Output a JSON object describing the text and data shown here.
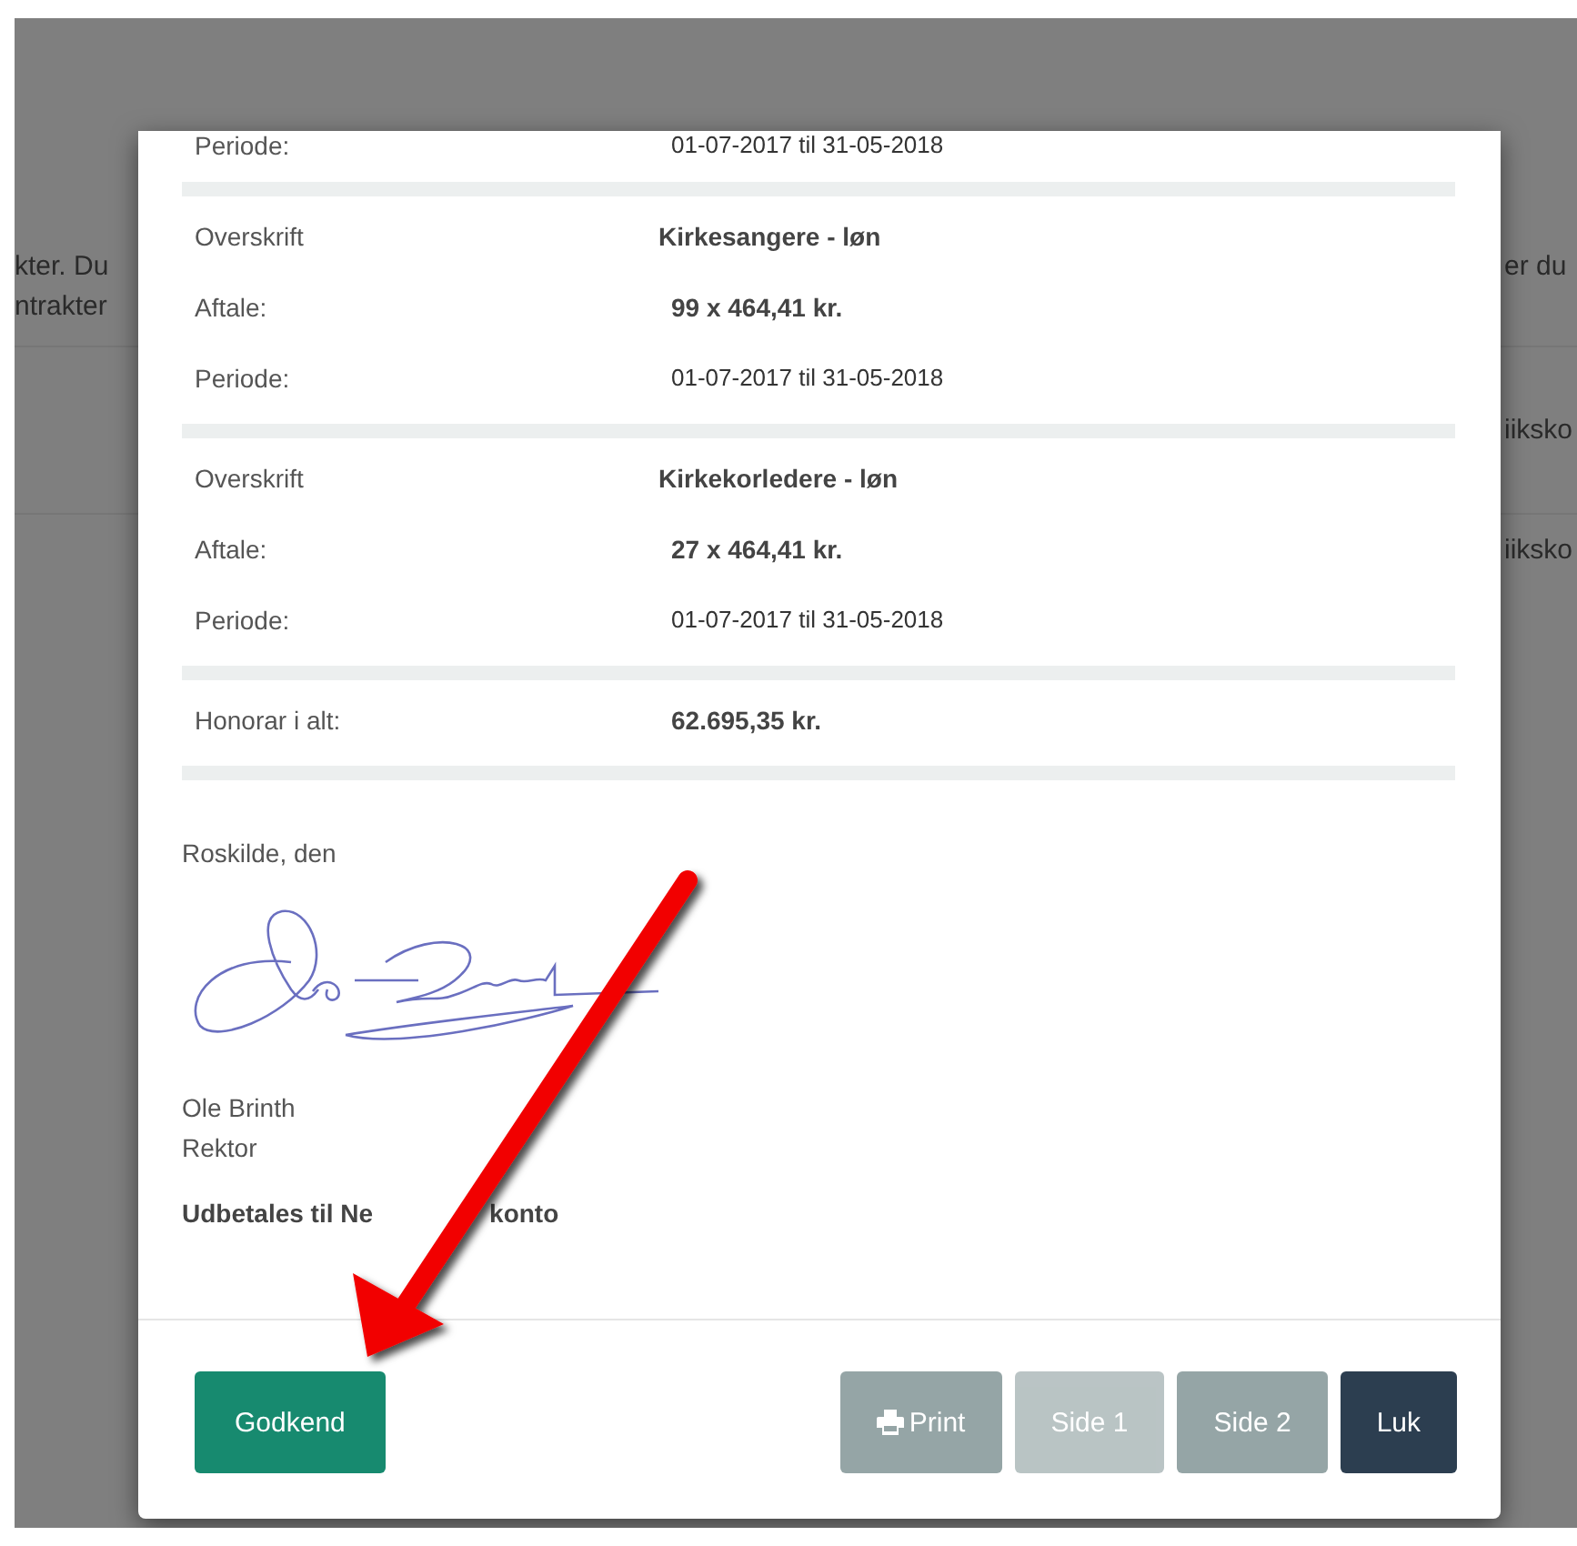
{
  "background_page": {
    "left_texts": [
      "kter. Du",
      "ntrakter"
    ],
    "right_texts": [
      "er du",
      "iiksko",
      "iiksko"
    ]
  },
  "dialog": {
    "sections": [
      {
        "rows": [
          {
            "label": "Periode:",
            "value": "01-07-2017 til 31-05-2018",
            "kind": "period"
          }
        ]
      },
      {
        "rows": [
          {
            "label": "Overskrift",
            "value": "Kirkesangere - løn",
            "kind": "heading"
          },
          {
            "label": "Aftale:",
            "value": "99 x 464,41 kr.",
            "kind": "amount"
          },
          {
            "label": "Periode:",
            "value": "01-07-2017 til 31-05-2018",
            "kind": "period"
          }
        ]
      },
      {
        "rows": [
          {
            "label": "Overskrift",
            "value": "Kirkekorledere - løn",
            "kind": "heading"
          },
          {
            "label": "Aftale:",
            "value": "27 x 464,41 kr.",
            "kind": "amount"
          },
          {
            "label": "Periode:",
            "value": "01-07-2017 til 31-05-2018",
            "kind": "period"
          }
        ]
      },
      {
        "rows": [
          {
            "label": "Honorar i alt:",
            "value": "62.695,35 kr.",
            "kind": "amount"
          }
        ]
      }
    ],
    "place": "Roskilde, den",
    "signer_name": "Ole Brinth",
    "signer_title": "Rektor",
    "payment_note_parts": [
      "Udbetales til Ne",
      "konto"
    ],
    "buttons_left": [
      {
        "label": "Godkend",
        "kind": "success",
        "disabled": false
      }
    ],
    "buttons_right": [
      {
        "label": "Print",
        "kind": "print",
        "disabled": false
      },
      {
        "label": "Side 1",
        "kind": "default",
        "disabled": true
      },
      {
        "label": "Side 2",
        "kind": "default",
        "disabled": false
      },
      {
        "label": "Luk",
        "kind": "dark",
        "disabled": false
      }
    ]
  }
}
